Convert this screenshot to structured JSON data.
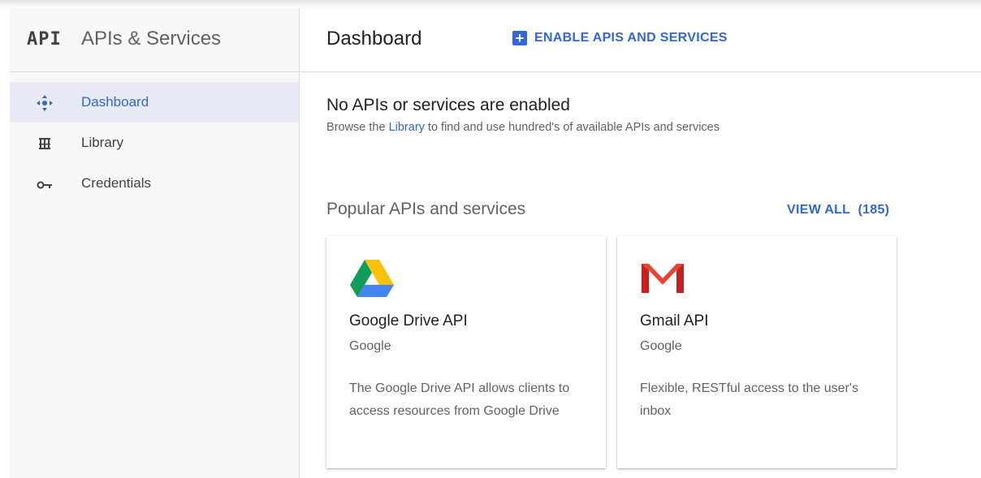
{
  "sidebar": {
    "logo": "API",
    "title": "APIs & Services",
    "items": [
      {
        "label": "Dashboard",
        "icon": "dashboard-icon",
        "active": true
      },
      {
        "label": "Library",
        "icon": "library-icon",
        "active": false
      },
      {
        "label": "Credentials",
        "icon": "key-icon",
        "active": false
      }
    ]
  },
  "header": {
    "title": "Dashboard",
    "enable_button": {
      "icon": "plus-icon",
      "label": "ENABLE APIS AND SERVICES"
    }
  },
  "empty_state": {
    "title": "No APIs or services are enabled",
    "desc_before": "Browse the ",
    "desc_link": "Library",
    "desc_after": " to find and use hundred's of available APIs and services"
  },
  "popular": {
    "title": "Popular APIs and services",
    "view_all": "VIEW ALL  (185)",
    "cards": [
      {
        "icon": "google-drive-icon",
        "title": "Google Drive API",
        "vendor": "Google",
        "description": "The Google Drive API allows clients to access resources from Google Drive"
      },
      {
        "icon": "gmail-icon",
        "title": "Gmail API",
        "vendor": "Google",
        "description": "Flexible, RESTful access to the user's inbox"
      }
    ]
  },
  "colors": {
    "accent": "#3367d6",
    "active_bg": "#e8eaf6",
    "sidebar_bg": "#f8f8f8"
  }
}
